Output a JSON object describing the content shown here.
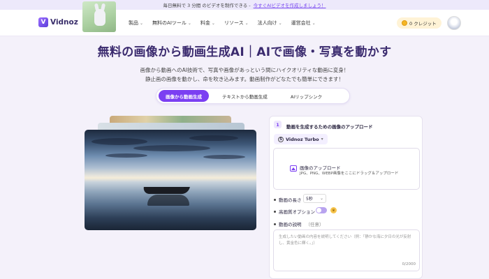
{
  "announcement": {
    "text": "毎日無料で 3 分間 のビデオを制作できる - ",
    "link": "今すぐAIビデオを作成しましょう！"
  },
  "nav": {
    "logo_text": "Vidnoz",
    "items": [
      {
        "label": "製品"
      },
      {
        "label": "無料のAIツール"
      },
      {
        "label": "料金"
      },
      {
        "label": "リソース"
      },
      {
        "label": "法人向け"
      },
      {
        "label": "運営会社"
      }
    ],
    "credit": "0 クレジット"
  },
  "hero": {
    "headline": "無料の画像から動画生成AI｜AIで画像・写真を動かす",
    "subline1": "画像から動画へのAI技術で、写真や画像があっという間にハイクオリティな動画に変身！",
    "subline2": "静止画の画像を動かし、命を吹き込みます。動画制作がどなたでも簡単にできます！"
  },
  "tabs": [
    {
      "label": "画像から動画生成",
      "active": true
    },
    {
      "label": "テキストから動画生成",
      "active": false
    },
    {
      "label": "AIリップシンク",
      "active": false
    }
  ],
  "panel": {
    "step": "1",
    "title": "動画を生成するための画像のアップロード",
    "model": "Vidnoz Turbo",
    "upload_title": "画像のアップロード",
    "upload_sub": "JPG、PNG、WEBP画像をここにドラッグ＆アップロード",
    "duration_label": "動画の長さ",
    "duration_value": "5秒",
    "hq_label": "高画質オプション",
    "desc_label": "動画の説明",
    "desc_optional": "（任意）",
    "desc_placeholder": "生成したい動画の内容を説明してください（例：「静かな海に夕日の光が反射し、黄金色に輝く。」）",
    "counter": "0/2000"
  }
}
